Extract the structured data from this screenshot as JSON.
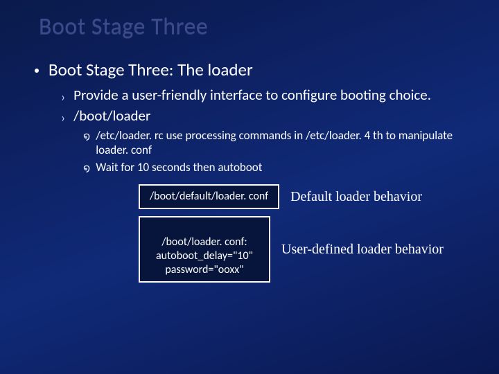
{
  "title": "Boot Stage Three",
  "level1": "Boot Stage Three: The loader",
  "level2": [
    "Provide a user-friendly interface to configure booting choice.",
    "/boot/loader"
  ],
  "level3": [
    "/etc/loader. rc use processing commands in /etc/loader. 4 th to manipulate loader. conf",
    "Wait for 10 seconds then autoboot"
  ],
  "boxes": [
    {
      "content": "/boot/default/loader. conf",
      "caption": "Default loader behavior"
    },
    {
      "content": "/boot/loader. conf:\nautoboot_delay=\"10\"\npassword=\"ooxx\"",
      "caption": "User-defined loader behavior"
    }
  ]
}
